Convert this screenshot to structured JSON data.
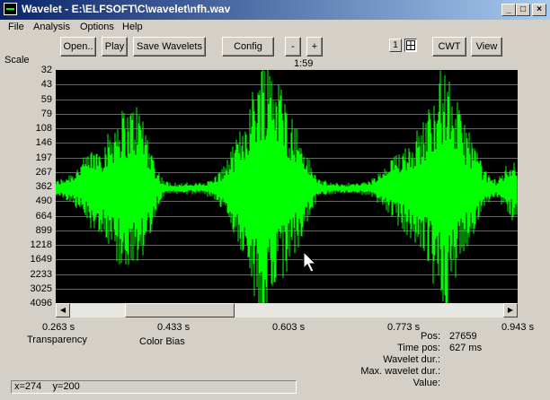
{
  "window": {
    "title": "Wavelet - E:\\ELFSOFT\\C\\wavelet\\nfh.wav",
    "minimize": "_",
    "maximize": "□",
    "close": "×"
  },
  "menu": [
    "File",
    "Analysis",
    "Options",
    "Help"
  ],
  "toolbar": {
    "open": "Open..",
    "play": "Play",
    "save_wavelets": "Save Wavelets",
    "config": "Config",
    "minus": "-",
    "plus": "+",
    "view_1": "1",
    "cwt": "CWT",
    "view": "View"
  },
  "scale_label": "Scale",
  "time_readout": "1:59",
  "y_axis": [
    "32",
    "43",
    "59",
    "79",
    "108",
    "146",
    "197",
    "267",
    "362",
    "490",
    "664",
    "899",
    "1218",
    "1649",
    "2233",
    "3025",
    "4096"
  ],
  "x_axis": [
    "0.263 s",
    "0.433 s",
    "0.603 s",
    "0.773 s",
    "0.943 s"
  ],
  "scroll_position": 0.17,
  "colors": {
    "waveform": "#00ff00",
    "plot_bg": "#000000",
    "gridline": "#ffffff"
  },
  "labels": {
    "transparency": "Transparency",
    "color_bias": "Color Bias"
  },
  "info": [
    {
      "label": "Pos:",
      "value": "27659"
    },
    {
      "label": "Time pos:",
      "value": "627 ms"
    },
    {
      "label": "Wavelet dur.:",
      "value": ""
    },
    {
      "label": "Max. wavelet dur.:",
      "value": ""
    },
    {
      "label": "Value:",
      "value": ""
    }
  ],
  "status": {
    "x": "x=274",
    "y": "y=200"
  }
}
